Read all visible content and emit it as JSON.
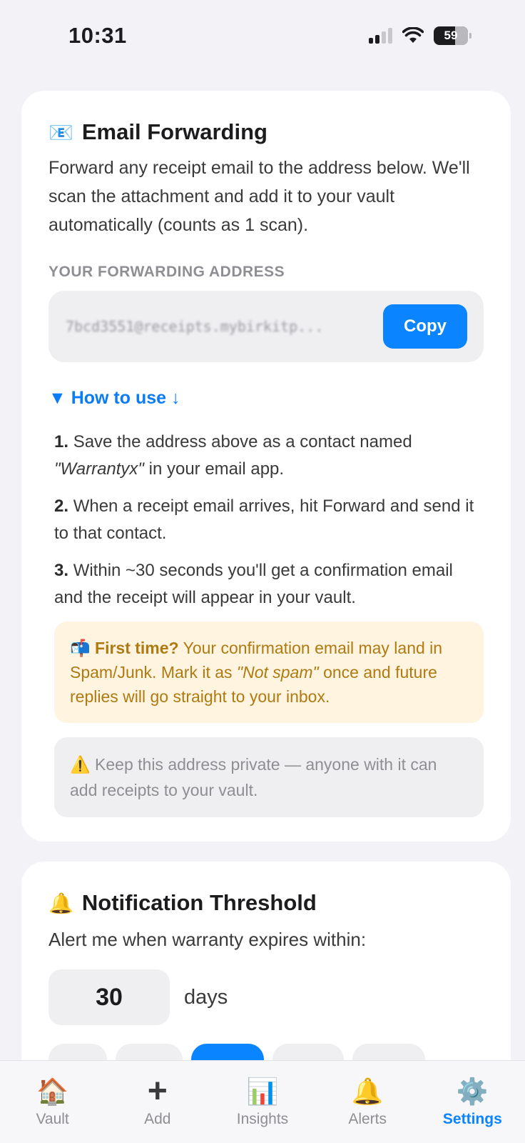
{
  "status_bar": {
    "time": "10:31",
    "battery": "59"
  },
  "email_card": {
    "icon": "📧",
    "title": "Email Forwarding",
    "description": "Forward any receipt email to the address below. We'll scan the attachment and add it to your vault automatically (counts as 1 scan).",
    "address_label": "YOUR FORWARDING ADDRESS",
    "address": "7bcd3551@receipts.mybirkitp...",
    "copy_label": "Copy",
    "how_to_label": "▼ How to use ↓",
    "steps": [
      {
        "num": "1.",
        "text_before": "Save the address above as a contact named ",
        "italic": "\"Warrantyx\"",
        "text_after": " in your email app."
      },
      {
        "num": "2.",
        "text": "When a receipt email arrives, hit Forward and send it to that contact."
      },
      {
        "num": "3.",
        "text": "Within ~30 seconds you'll get a confirmation email and the receipt will appear in your vault."
      }
    ],
    "first_time_note": {
      "icon": "📬",
      "bold": "First time?",
      "text_before": " Your confirmation email may land in Spam/Junk. Mark it as ",
      "italic": "\"Not spam\"",
      "text_after": " once and future replies will go straight to your inbox."
    },
    "private_note": {
      "icon": "⚠️",
      "text": "Keep this address private — anyone with it can add receipts to your vault."
    }
  },
  "notif_card": {
    "icon": "🔔",
    "title": "Notification Threshold",
    "description": "Alert me when warranty expires within:",
    "days_value": "30",
    "days_unit": "days"
  },
  "tab_bar": {
    "tabs": [
      {
        "icon": "🏠",
        "label": "Vault"
      },
      {
        "icon": "+",
        "label": "Add"
      },
      {
        "icon": "📊",
        "label": "Insights"
      },
      {
        "icon": "🔔",
        "label": "Alerts"
      },
      {
        "icon": "⚙️",
        "label": "Settings"
      }
    ],
    "active": "Settings"
  },
  "colors": {
    "accent": "#0a84ff",
    "warning_bg": "#fff4df",
    "warning_text": "#b07a12"
  }
}
